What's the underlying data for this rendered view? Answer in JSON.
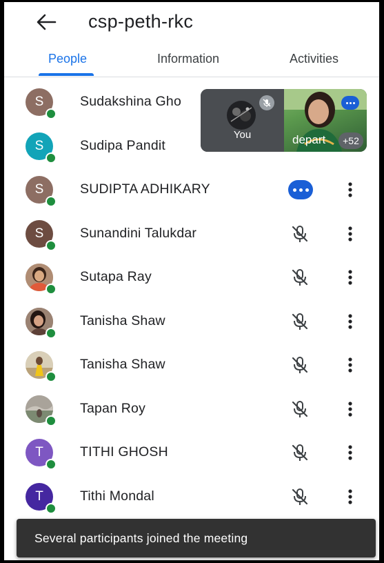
{
  "header": {
    "title": "csp-peth-rkc"
  },
  "tabs": [
    {
      "label": "People",
      "active": true
    },
    {
      "label": "Information",
      "active": false
    },
    {
      "label": "Activities",
      "active": false
    }
  ],
  "participants": [
    {
      "name": "Sudakshina Gho",
      "initial": "S",
      "avatar_color": "#8d6e63",
      "mic": "hidden"
    },
    {
      "name": "Sudipa Pandit",
      "initial": "S",
      "avatar_color": "#12a4b8",
      "mic": "hidden"
    },
    {
      "name": "SUDIPTA ADHIKARY",
      "initial": "S",
      "avatar_color": "#8d6e63",
      "mic": "speaking"
    },
    {
      "name": "Sunandini Talukdar",
      "initial": "S",
      "avatar_color": "#6d4c41",
      "mic": "muted"
    },
    {
      "name": "Sutapa Ray",
      "initial": "",
      "avatar_color": "#a1887f",
      "mic": "muted"
    },
    {
      "name": "Tanisha Shaw",
      "initial": "",
      "avatar_color": "#795548",
      "mic": "muted"
    },
    {
      "name": "Tanisha Shaw",
      "initial": "",
      "avatar_color": "#c8b99b",
      "mic": "muted"
    },
    {
      "name": "Tapan Roy",
      "initial": "",
      "avatar_color": "#8f8a80",
      "mic": "muted"
    },
    {
      "name": "TITHI GHOSH",
      "initial": "T",
      "avatar_color": "#7e57c2",
      "mic": "muted"
    },
    {
      "name": "Tithi Mondal",
      "initial": "T",
      "avatar_color": "#4527a0",
      "mic": "muted"
    }
  ],
  "pip": {
    "self_label": "You",
    "tile_label": "depart",
    "others_count": "+52"
  },
  "snackbar": {
    "message": "Several participants joined the meeting"
  },
  "colors": {
    "accent": "#1a73e8",
    "presence": "#1e8e3e",
    "speaking": "#1a5fd6"
  }
}
